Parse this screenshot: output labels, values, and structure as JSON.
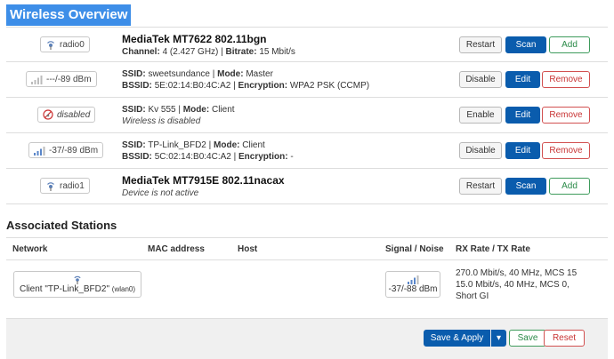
{
  "page_title": "Wireless Overview",
  "radios": [
    {
      "badge": "radio0",
      "title": "MediaTek MT7622 802.11bgn",
      "channel_label": "Channel:",
      "channel_value": "4 (2.427 GHz)",
      "bitrate_label": "Bitrate:",
      "bitrate_value": "15 Mbit/s",
      "buttons": [
        "Restart",
        "Scan",
        "Add"
      ]
    },
    {
      "badge": "radio1",
      "title": "MediaTek MT7915E 802.11nacax",
      "status": "Device is not active",
      "buttons": [
        "Restart",
        "Scan",
        "Add"
      ]
    }
  ],
  "networks": [
    {
      "badge": "---/-89 dBm",
      "ssid_label": "SSID:",
      "ssid": "sweetsundance",
      "mode_label": "Mode:",
      "mode": "Master",
      "bssid_label": "BSSID:",
      "bssid": "5E:02:14:B0:4C:A2",
      "enc_label": "Encryption:",
      "enc": "WPA2 PSK (CCMP)",
      "buttons": [
        "Disable",
        "Edit",
        "Remove"
      ]
    },
    {
      "badge": "disabled",
      "ssid_label": "SSID:",
      "ssid": "Kv 555",
      "mode_label": "Mode:",
      "mode": "Client",
      "status": "Wireless is disabled",
      "buttons": [
        "Enable",
        "Edit",
        "Remove"
      ]
    },
    {
      "badge": "-37/-89 dBm",
      "ssid_label": "SSID:",
      "ssid": "TP-Link_BFD2",
      "mode_label": "Mode:",
      "mode": "Client",
      "bssid_label": "BSSID:",
      "bssid": "5C:02:14:B0:4C:A2",
      "enc_label": "Encryption:",
      "enc": "-",
      "buttons": [
        "Disable",
        "Edit",
        "Remove"
      ]
    }
  ],
  "stations": {
    "title": "Associated Stations",
    "columns": [
      "Network",
      "MAC address",
      "Host",
      "Signal / Noise",
      "RX Rate / TX Rate"
    ],
    "rows": [
      {
        "network": "Client \"TP-Link_BFD2\"",
        "iface": "(wlan0)",
        "mac": "",
        "host": "",
        "signal": "-37/-88 dBm",
        "rx": "270.0 Mbit/s, 40 MHz, MCS 15",
        "tx": "15.0 Mbit/s, 40 MHz, MCS 0,",
        "tx2": "Short GI"
      }
    ]
  },
  "footer": {
    "save_apply": "Save & Apply",
    "dropdown": "▾",
    "save": "Save",
    "reset": "Reset"
  },
  "colors": {
    "primary": "#0a5cad",
    "title_bg": "#3d8ee8",
    "add": "#2a8a48",
    "remove": "#c83434"
  }
}
